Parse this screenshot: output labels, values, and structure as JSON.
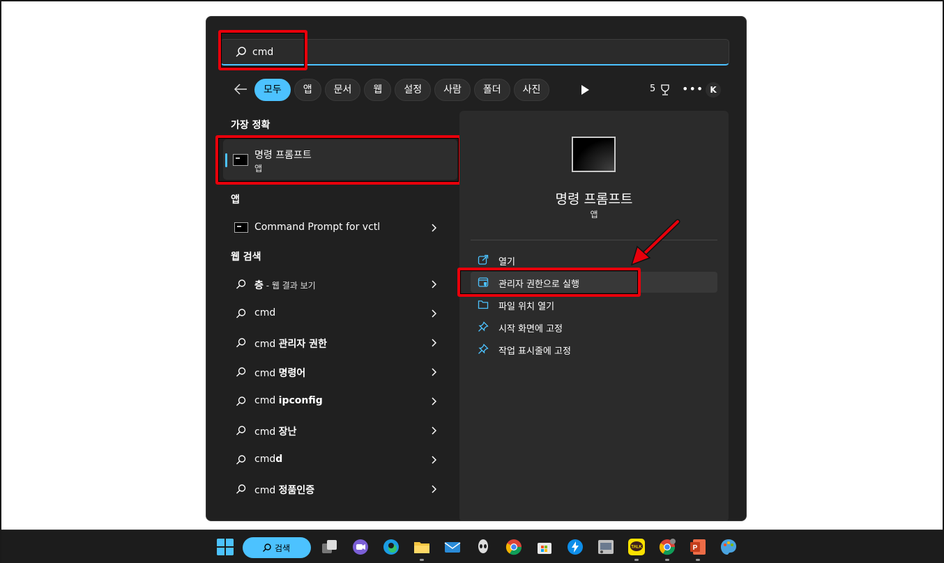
{
  "search": {
    "query": "cmd"
  },
  "filters": {
    "tabs": [
      "모두",
      "앱",
      "문서",
      "웹",
      "설정",
      "사람",
      "폴더",
      "사진"
    ],
    "active_index": 0,
    "points": "5",
    "avatar_initial": "K"
  },
  "best_match": {
    "section": "가장 정확",
    "name": "명령 프롬프트",
    "type": "앱"
  },
  "apps": {
    "section": "앱",
    "items": [
      "Command Prompt for vctl"
    ]
  },
  "web": {
    "section": "웹 검색",
    "items": [
      {
        "prefix": "",
        "bold": "층",
        "suffix": " - 웹 결과 보기"
      },
      {
        "prefix": "cmd",
        "bold": "",
        "suffix": ""
      },
      {
        "prefix": "cmd ",
        "bold": "관리자 권한",
        "suffix": ""
      },
      {
        "prefix": "cmd ",
        "bold": "명령어",
        "suffix": ""
      },
      {
        "prefix": "cmd ",
        "bold": "ipconfig",
        "suffix": ""
      },
      {
        "prefix": "cmd ",
        "bold": "장난",
        "suffix": ""
      },
      {
        "prefix": "cmd",
        "bold": "d",
        "suffix": ""
      },
      {
        "prefix": "cmd ",
        "bold": "정품인증",
        "suffix": ""
      }
    ]
  },
  "preview": {
    "title": "명령 프롬프트",
    "type": "앱",
    "actions": [
      "열기",
      "관리자 권한으로 실행",
      "파일 위치 열기",
      "시작 화면에 고정",
      "작업 표시줄에 고정"
    ],
    "highlighted_index": 1
  },
  "taskbar": {
    "search_label": "검색",
    "apps": [
      "start-icon",
      "task-view-icon",
      "chat-icon",
      "edge-icon",
      "file-explorer-icon",
      "mail-icon",
      "alienware-icon",
      "chrome-icon",
      "store-icon",
      "teamviewer-icon",
      "app-icon",
      "kakaotalk-icon",
      "chrome-profile-icon",
      "powerpoint-icon",
      "paint-icon"
    ]
  },
  "colors": {
    "accent": "#4cc2ff",
    "highlight_box": "#e8000b",
    "panel": "#202020"
  }
}
